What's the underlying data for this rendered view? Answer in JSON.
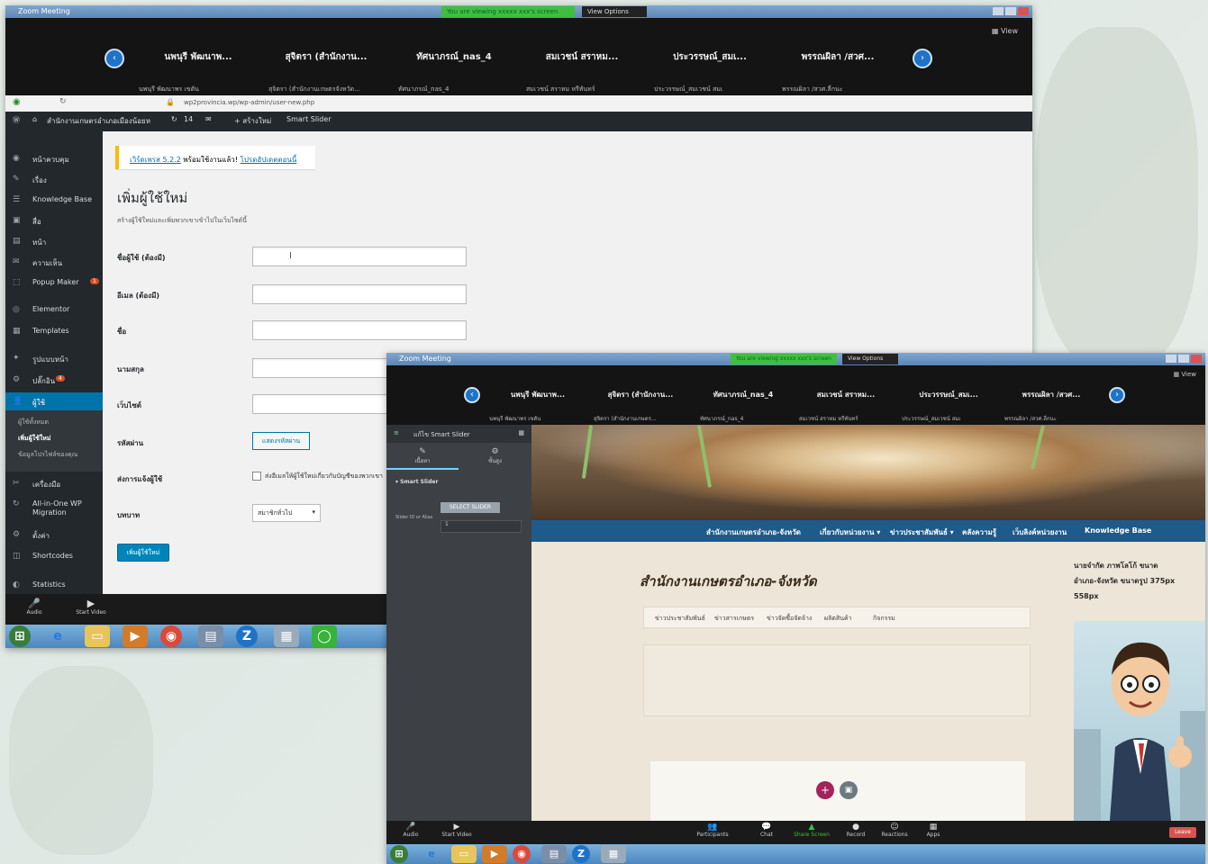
{
  "zoom_top": {
    "title": "Zoom Meeting",
    "share_text": "You are viewing xxxxx xxx's screen",
    "view_options": "View Options",
    "view": "View",
    "participants": [
      {
        "name": "นพนุรี พัฒนาพ...",
        "sub": "นพนุรี พัฒนาพร เขตัน"
      },
      {
        "name": "สุจิตรา (สำนักงาน...",
        "sub": "สุจิตรา (สำนักงานเกษตรจังหวัด..."
      },
      {
        "name": "ทัศนาภรณ์_nas_4",
        "sub": "ทัศนาภรณ์_nas_4"
      },
      {
        "name": "สมเวชน์ สราหม...",
        "sub": "สมเวชน์ สราหม หรีทันทร์"
      },
      {
        "name": "ประวรรษณ์_สมเ...",
        "sub": "ประวรรษณ์_สมเวชน์ สมเ"
      },
      {
        "name": "พรรณผิลา /สวศ...",
        "sub": "พรรณผิลา /สวศ.ลี่กนะ"
      }
    ]
  },
  "browser": {
    "url": "wp2provincia.wp/wp-admin/user-new.php",
    "adminbar": {
      "site": "สำนักงานเกษตรอำเภอเมืองน้อยห",
      "comments": "14",
      "new": "+ สร้างใหม่",
      "plugin": "Smart Slider"
    }
  },
  "wp_sidebar": {
    "items": [
      {
        "icon": "◉",
        "label": "หน้าควบคุม"
      },
      {
        "icon": "✎",
        "label": "เรื่อง"
      },
      {
        "icon": "☰",
        "label": "Knowledge Base"
      },
      {
        "icon": "▣",
        "label": "สื่อ"
      },
      {
        "icon": "▤",
        "label": "หน้า"
      },
      {
        "icon": "✉",
        "label": "ความเห็น"
      },
      {
        "icon": "⬚",
        "label": "Popup Maker",
        "badge": "1"
      },
      {
        "icon": "◎",
        "label": "Elementor"
      },
      {
        "icon": "▦",
        "label": "Templates"
      },
      {
        "icon": "✦",
        "label": "รูปแบบหน้า"
      },
      {
        "icon": "⚙",
        "label": "ปลั๊กอิน",
        "badge": "4"
      },
      {
        "icon": "👤",
        "label": "ผู้ใช้"
      },
      {
        "icon": "✂",
        "label": "เครื่องมือ"
      },
      {
        "icon": "↻",
        "label": "All-in-One WP Migration"
      },
      {
        "icon": "⚙",
        "label": "ตั้งค่า"
      },
      {
        "icon": "◫",
        "label": "Shortcodes"
      },
      {
        "icon": "◐",
        "label": "Statistics"
      }
    ],
    "sub_items": [
      "ผู้ใช้ทั้งหมด",
      "เพิ่มผู้ใช้ใหม่",
      "ข้อมูลโปรไฟล์ของคุณ"
    ]
  },
  "wp_form": {
    "notice_link1": "เวิร์ดเพรส 5.2.2",
    "notice_text": "พร้อมใช้งานแล้ว!",
    "notice_link2": "โปรดอัปเดตตอนนี้",
    "title": "เพิ่มผู้ใช้ใหม่",
    "description": "สร้างผู้ใช้ใหม่และเพิ่มพวกเขาเข้าไปในเว็บไซต์นี้",
    "fields": [
      {
        "label": "ชื่อผู้ใช้ (ต้องมี)",
        "value": "I"
      },
      {
        "label": "อีเมล (ต้องมี)",
        "value": ""
      },
      {
        "label": "ชื่อ",
        "value": ""
      },
      {
        "label": "นามสกุล",
        "value": ""
      },
      {
        "label": "เว็บไซต์",
        "value": ""
      }
    ],
    "password_label": "รหัสผ่าน",
    "password_button": "แสดงรหัสผ่าน",
    "notify_label": "ส่งการแจ้งผู้ใช้",
    "notify_text": "ส่งอีเมลให้ผู้ใช้ใหม่เกี่ยวกับบัญชีของพวกเขา",
    "role_label": "บทบาท",
    "role_value": "สมาชิกทั่วไป",
    "submit": "เพิ่มผู้ใช้ใหม่"
  },
  "zoom_controls_left": {
    "audio": "Audio",
    "video": "Start Video"
  },
  "zoom_bottom": {
    "title": "Zoom Meeting",
    "share_text": "You are viewing xxxxx xxx's screen",
    "view_options": "View Options",
    "view": "View",
    "participants": [
      {
        "name": "นพนุรี พัฒนาพ...",
        "sub": "นพนุรี พัฒนาพร เขตัน"
      },
      {
        "name": "สุจิตรา (สำนักงาน...",
        "sub": "สุจิตรา (สำนักงานเกษตร..."
      },
      {
        "name": "ทัศนาภรณ์_nas_4",
        "sub": "ทัศนาภรณ์_nas_4"
      },
      {
        "name": "สมเวชน์ สราหม...",
        "sub": "สมเวชน์ สราหม หรีทันทร์"
      },
      {
        "name": "ประวรรษณ์_สมเ...",
        "sub": "ประวรรษณ์_สมเวชน์ สมเ"
      },
      {
        "name": "พรรณผิลา /สวศ...",
        "sub": "พรรณผิลา /สวศ.ลี่กนะ"
      }
    ],
    "controls": {
      "audio": "Audio",
      "video": "Start Video",
      "participants": "Participants",
      "chat": "Chat",
      "share": "Share Screen",
      "record": "Record",
      "reactions": "Reactions",
      "apps": "Apps",
      "leave": "Leave"
    }
  },
  "elementor": {
    "header": "แก้ไข Smart Slider",
    "tab1": "เนื้อหา",
    "tab2": "ขั้นสูง",
    "section": "Smart Slider",
    "button": "SELECT SLIDER",
    "field_label": "Slider ID or Alias",
    "field_value": "1"
  },
  "site": {
    "nav": [
      "สำนักงานเกษตรอำเภอ-จังหวัด",
      "เกี่ยวกับหน่วยงาน ▾",
      "ข่าวประชาสัมพันธ์ ▾",
      "คลังความรู้",
      "เว็บลิงค์หน่วยงาน",
      "Knowledge Base"
    ],
    "title": "สำนักงานเกษตรอำเภอ-จังหวัด",
    "tabs": [
      "ข่าวประชาสัมพันธ์",
      "ข่าวสารเกษตร",
      "ข่าวจัดซื้อจัดจ้าง",
      "ผลิตสินค้า",
      "กิจกรรม"
    ],
    "side_text": [
      "นายจำกัด ภาพโลโก้ ขนาด",
      "อำเภอ-จังหวัด ขนาดรูป 375px",
      "558px"
    ]
  },
  "colors": {
    "wp_admin": "#23282d",
    "wp_blue": "#0073aa",
    "site_nav": "#1e5a8a",
    "zoom_green": "#3fbf3f",
    "leave_red": "#d9534f"
  }
}
